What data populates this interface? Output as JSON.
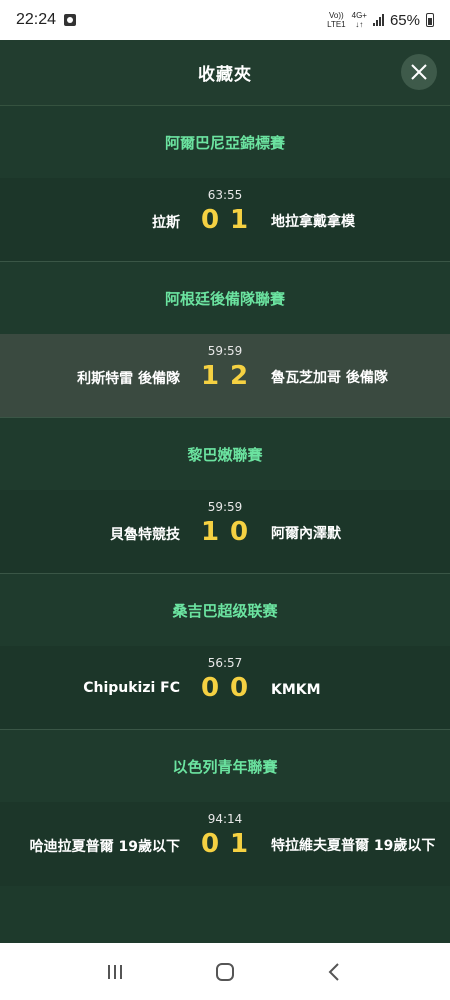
{
  "status_bar": {
    "time": "22:24",
    "network_top": "Vo))",
    "network_bottom": "LTE1",
    "network2_top": "4G+",
    "network2_bottom": "↓↑",
    "battery": "65%"
  },
  "header": {
    "title": "收藏夾",
    "close_icon": "close-icon"
  },
  "leagues": [
    {
      "name": "阿爾巴尼亞錦標賽",
      "match": {
        "time": "63:55",
        "home": "拉斯",
        "home_score": "0",
        "away_score": "1",
        "away": "地拉拿戴拿模",
        "highlight": false
      }
    },
    {
      "name": "阿根廷後備隊聯賽",
      "match": {
        "time": "59:59",
        "home": "利斯特雷 後備隊",
        "home_score": "1",
        "away_score": "2",
        "away": "魯瓦芝加哥 後備隊",
        "highlight": true
      }
    },
    {
      "name": "黎巴嫩聯賽",
      "match": {
        "time": "59:59",
        "home": "貝魯特競技",
        "home_score": "1",
        "away_score": "0",
        "away": "阿爾內澤默",
        "highlight": false
      }
    },
    {
      "name": "桑吉巴超级联赛",
      "match": {
        "time": "56:57",
        "home": "Chipukizi FC",
        "home_score": "0",
        "away_score": "0",
        "away": "KMKM",
        "highlight": false
      }
    },
    {
      "name": "以色列青年聯賽",
      "match": {
        "time": "94:14",
        "home": "哈迪拉夏普爾 19歲以下",
        "home_score": "0",
        "away_score": "1",
        "away": "特拉維夫夏普爾 19歲以下",
        "highlight": false
      }
    }
  ],
  "nav_bar": {
    "recent_icon": "recent-apps-icon",
    "home_icon": "home-icon",
    "back_icon": "back-icon"
  },
  "colors": {
    "background": "#1e3a2c",
    "league_name": "#6be3a0",
    "score": "#f5d142",
    "highlight_row": "#3a4a40"
  }
}
